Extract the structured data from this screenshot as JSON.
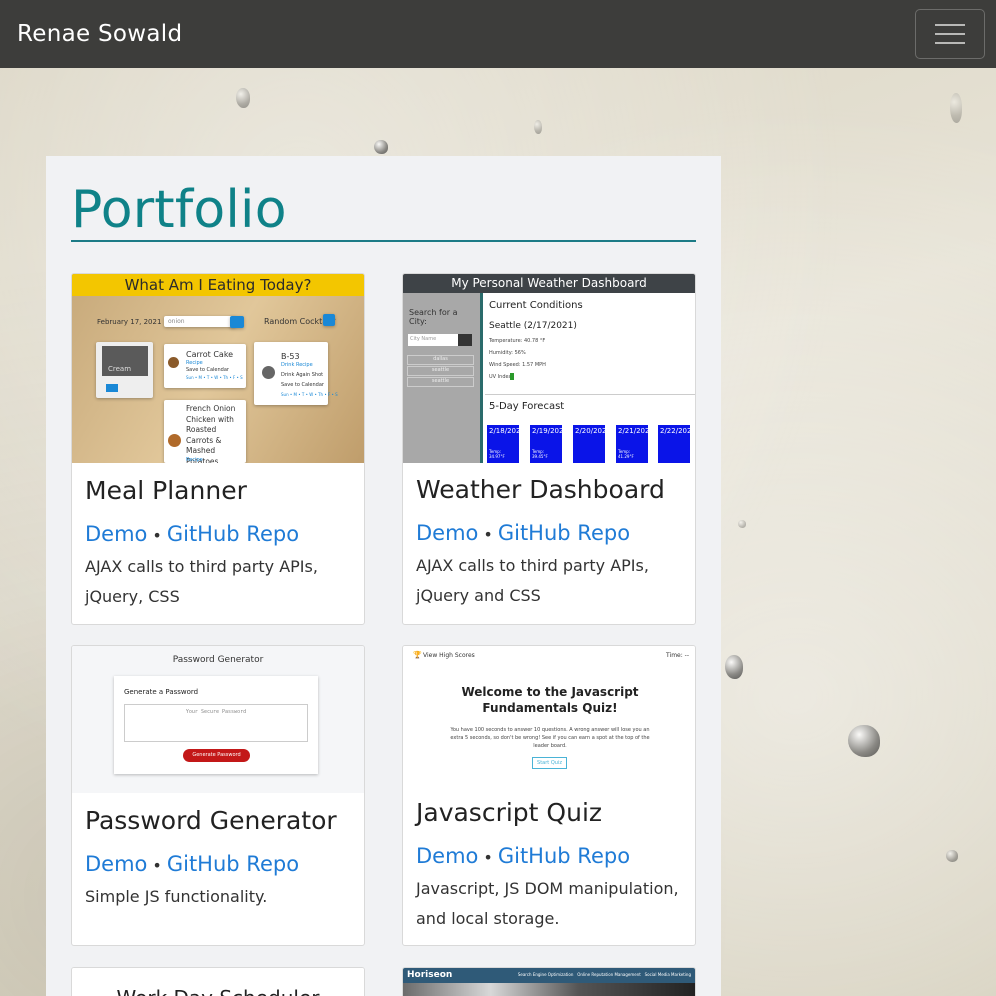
{
  "navbar": {
    "brand": "Renae Sowald",
    "toggler_icon": "hamburger-menu-icon"
  },
  "page": {
    "title": "Portfolio"
  },
  "projects": [
    {
      "title": "Meal Planner",
      "demo": "Demo",
      "repo": "GitHub Repo",
      "separator": "•",
      "description": "AJAX calls to third party APIs, jQuery, CSS",
      "thumb": {
        "banner": "What Am I Eating Today?",
        "date": "February 17, 2021",
        "search_value": "onion",
        "random_label": "Random Cocktail?",
        "recipe1": "Carrot Cake",
        "recipe2": "B-53",
        "recipe3": "French Onion Chicken with Roasted Carrots & Mashed Potatoes",
        "recipe_link": "Recipe",
        "recipe1_save": "Save to Calendar",
        "recipe1_days": "Sun • M • T • W • Th • F • S",
        "recipe2_link": "Drink Recipe",
        "recipe2_sub": "Drink Again Shot",
        "recipe2_save": "Save to Calendar",
        "recipe2_days": "Sun • M • T • W • Th • F • S",
        "recipe3_link": "Recipe",
        "overlay_text": "Cream",
        "clear_button": "Clear"
      }
    },
    {
      "title": "Weather Dashboard",
      "demo": "Demo",
      "repo": "GitHub Repo",
      "separator": "•",
      "description": "AJAX calls to third party APIs, jQuery and CSS",
      "thumb": {
        "header": "My Personal Weather Dashboard",
        "search_label": "Search for a City:",
        "city_placeholder": "City Name",
        "city_list": [
          "dallas",
          "seattle",
          "seattle"
        ],
        "current": "Current Conditions",
        "city": "Seattle (2/17/2021)",
        "temp": "Temperature: 40.78 °F",
        "humidity": "Humidity: 56%",
        "wind": "Wind Speed: 1.57 MPH",
        "uv": "UV Index:",
        "forecast": "5-Day Forecast",
        "days": [
          "2/18/2021",
          "2/19/2021",
          "2/20/2021",
          "2/21/2021",
          "2/22/2021"
        ],
        "temps": [
          "Temp: 34.97°F",
          "Temp: 39.45°F",
          "",
          "Temp: 41.29°F",
          ""
        ]
      }
    },
    {
      "title": "Password Generator",
      "demo": "Demo",
      "repo": "GitHub Repo",
      "separator": "•",
      "description": "Simple JS functionality.",
      "thumb": {
        "header": "Password Generator",
        "card_title": "Generate a Password",
        "placeholder": "Your Secure Password",
        "button": "Generate Password"
      }
    },
    {
      "title": "Javascript Quiz",
      "demo": "Demo",
      "repo": "GitHub Repo",
      "separator": "•",
      "description": "Javascript, JS DOM manipulation, and local storage.",
      "thumb": {
        "high_scores": "View High Scores",
        "time": "Time: --",
        "heading": "Welcome to the Javascript Fundamentals Quiz!",
        "body": "You have 100 seconds to answer 10 questions. A wrong answer will lose you an extra 5 seconds, so don't be wrong! See if you can earn a spot at the top of the leader board.",
        "start": "Start Quiz"
      }
    },
    {
      "title": "",
      "thumb": {
        "header": "Work Day Scheduler"
      }
    },
    {
      "title": "",
      "thumb": {
        "brand": "Horiseon",
        "nav": "Search Engine Optimization   Online Reputation Management   Social Media Marketing"
      }
    }
  ]
}
